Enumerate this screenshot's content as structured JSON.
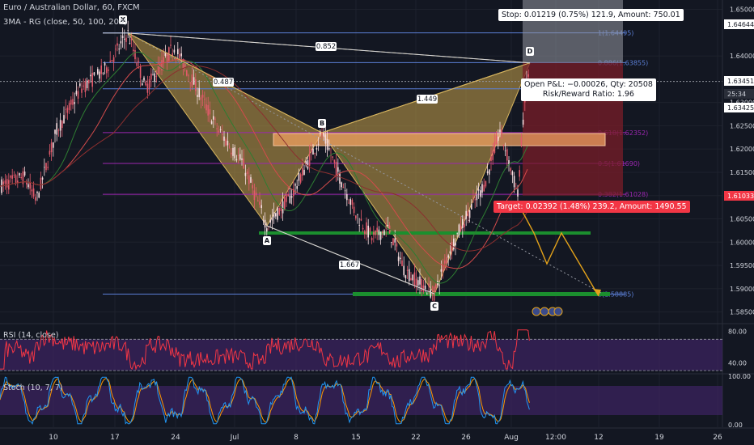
{
  "header": {
    "title": "Euro / Australian Dollar, 60, FXCM",
    "indicator": "3MA - RG (close, 50, 100, 200)"
  },
  "position": {
    "stop_text": "Stop: 0.01219 (0.75%) 121.9, Amount: 750.01",
    "target_text": "Target: 0.02392 (1.48%) 239.2, Amount: 1490.55",
    "pnl_text": "Open P&L: −0.00026, Qty: 20508",
    "rr_text": "Risk/Reward Ratio: 1.96"
  },
  "price_axis": {
    "ticks": [
      "1.65000",
      "1.64000",
      "1.63000",
      "1.62500",
      "1.62000",
      "1.61500",
      "1.61000",
      "1.60500",
      "1.60000",
      "1.59500",
      "1.59000",
      "1.58500"
    ],
    "badges": [
      {
        "text": "1.64644",
        "color": "#ffffff",
        "text_color": "#131722"
      },
      {
        "text": "1.63451",
        "color": "#ffffff",
        "text_color": "#131722"
      },
      {
        "text": "25:34",
        "color": "#2a2e39",
        "text_color": "#d1d4dc"
      },
      {
        "text": "1.63425",
        "color": "#ffffff",
        "text_color": "#131722"
      },
      {
        "text": "1.61033",
        "color": "#f23645",
        "text_color": "#ffffff"
      }
    ]
  },
  "time_axis": [
    "10",
    "17",
    "24",
    "Jul",
    "8",
    "15",
    "22",
    "26",
    "Aug",
    "12:00",
    "12",
    "19",
    "26"
  ],
  "pattern": {
    "points": [
      "X",
      "A",
      "B",
      "C",
      "D"
    ],
    "ratios": [
      "0.852",
      "0.487",
      "1.449",
      "1.667"
    ]
  },
  "fib_levels": [
    {
      "label": "1(1.64495)",
      "color": "#5b7fd6"
    },
    {
      "label": "0.886(1.63855)",
      "color": "#5b7fd6"
    },
    {
      "label": "0.786(1.63294)",
      "color": "#5b7fd6"
    },
    {
      "label": "0.618(1.62352)",
      "color": "#9c27b0"
    },
    {
      "label": "0.5(1.61690)",
      "color": "#9c27b0"
    },
    {
      "label": "0.382(1.61028)",
      "color": "#9c27b0"
    },
    {
      "label": "0(1.58885)",
      "color": "#5b7fd6"
    }
  ],
  "rsi": {
    "label": "RSI (14, close)",
    "ticks": [
      "80.00",
      "40.00"
    ]
  },
  "stoch": {
    "label": "Stoch (10, 7, 7)",
    "ticks": [
      "100.00",
      "0.00"
    ]
  },
  "colors": {
    "background": "#131722",
    "pattern_fill": "#c9a24a",
    "green_level": "#1b8f2e",
    "orange_box": "#f0a060",
    "arrow": "#e3a21a",
    "rsi_line": "#f23645",
    "rsi_band": "#3d2363",
    "stoch_k": "#2196f3",
    "stoch_d": "#ff9800"
  },
  "chart_data": {
    "type": "candlestick",
    "title": "Euro / Australian Dollar, 60, FXCM",
    "ylim": [
      1.5825,
      1.652
    ],
    "yticks": [
      1.65,
      1.64,
      1.63,
      1.625,
      1.62,
      1.615,
      1.61,
      1.605,
      1.6,
      1.595,
      1.59,
      1.585
    ],
    "xticks": [
      "10",
      "17",
      "24",
      "Jul",
      "8",
      "15",
      "22",
      "26",
      "Aug",
      "12:00",
      "12",
      "19",
      "26"
    ],
    "price_path": [
      {
        "x": 0,
        "y": 1.612
      },
      {
        "x": 30,
        "y": 1.614
      },
      {
        "x": 45,
        "y": 1.609
      },
      {
        "x": 70,
        "y": 1.624
      },
      {
        "x": 100,
        "y": 1.633
      },
      {
        "x": 130,
        "y": 1.637
      },
      {
        "x": 158,
        "y": 1.6449
      },
      {
        "x": 180,
        "y": 1.633
      },
      {
        "x": 215,
        "y": 1.642
      },
      {
        "x": 240,
        "y": 1.634
      },
      {
        "x": 270,
        "y": 1.624
      },
      {
        "x": 300,
        "y": 1.617
      },
      {
        "x": 330,
        "y": 1.6035
      },
      {
        "x": 360,
        "y": 1.61
      },
      {
        "x": 380,
        "y": 1.617
      },
      {
        "x": 398,
        "y": 1.6235
      },
      {
        "x": 420,
        "y": 1.614
      },
      {
        "x": 440,
        "y": 1.606
      },
      {
        "x": 460,
        "y": 1.601
      },
      {
        "x": 480,
        "y": 1.603
      },
      {
        "x": 500,
        "y": 1.594
      },
      {
        "x": 520,
        "y": 1.591
      },
      {
        "x": 537,
        "y": 1.5889
      },
      {
        "x": 555,
        "y": 1.598
      },
      {
        "x": 575,
        "y": 1.605
      },
      {
        "x": 600,
        "y": 1.613
      },
      {
        "x": 618,
        "y": 1.624
      },
      {
        "x": 628,
        "y": 1.618
      },
      {
        "x": 640,
        "y": 1.61
      },
      {
        "x": 648,
        "y": 1.63
      },
      {
        "x": 655,
        "y": 1.6385
      }
    ],
    "harmonic_pattern": {
      "X": 1.6449,
      "A": 1.6035,
      "B": 1.6235,
      "C": 1.5889,
      "D": 1.6385,
      "ratios": {
        "XB": 0.852,
        "AC": 0.487,
        "BD": 1.449,
        "XD": 1.667
      }
    },
    "fibonacci": [
      {
        "ratio": 1,
        "price": 1.64495
      },
      {
        "ratio": 0.886,
        "price": 1.63855
      },
      {
        "ratio": 0.786,
        "price": 1.63294
      },
      {
        "ratio": 0.618,
        "price": 1.62352
      },
      {
        "ratio": 0.5,
        "price": 1.6169
      },
      {
        "ratio": 0.382,
        "price": 1.61028
      },
      {
        "ratio": 0,
        "price": 1.58885
      }
    ],
    "current_price": 1.63451,
    "rsi_ylim": [
      30,
      90
    ],
    "stoch_ylim": [
      0,
      100
    ]
  }
}
